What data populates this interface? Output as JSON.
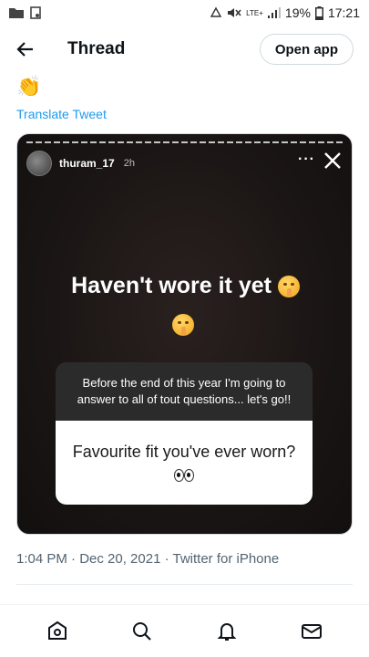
{
  "status_bar": {
    "battery": "19%",
    "time": "17:21",
    "network": "LTE+"
  },
  "header": {
    "title": "Thread",
    "open_app_label": "Open app"
  },
  "tweet": {
    "translate_label": "Translate Tweet",
    "timestamp": "1:04 PM · Dec 20, 2021 · Twitter for iPhone"
  },
  "story": {
    "username": "thuram_17",
    "time": "2h",
    "more": "···",
    "headline": "Haven't wore it yet",
    "prompt": "Before the end of this year I'm going to answer to all of tout questions... let's go!!",
    "question": "Favourite fit you've ever worn?"
  },
  "icons": {
    "back": "arrow-left-icon",
    "close": "close-icon",
    "home": "home-icon",
    "search": "search-icon",
    "notifications": "bell-icon",
    "messages": "mail-icon"
  },
  "colors": {
    "accent": "#1d9bf0",
    "muted_text": "#536471"
  }
}
